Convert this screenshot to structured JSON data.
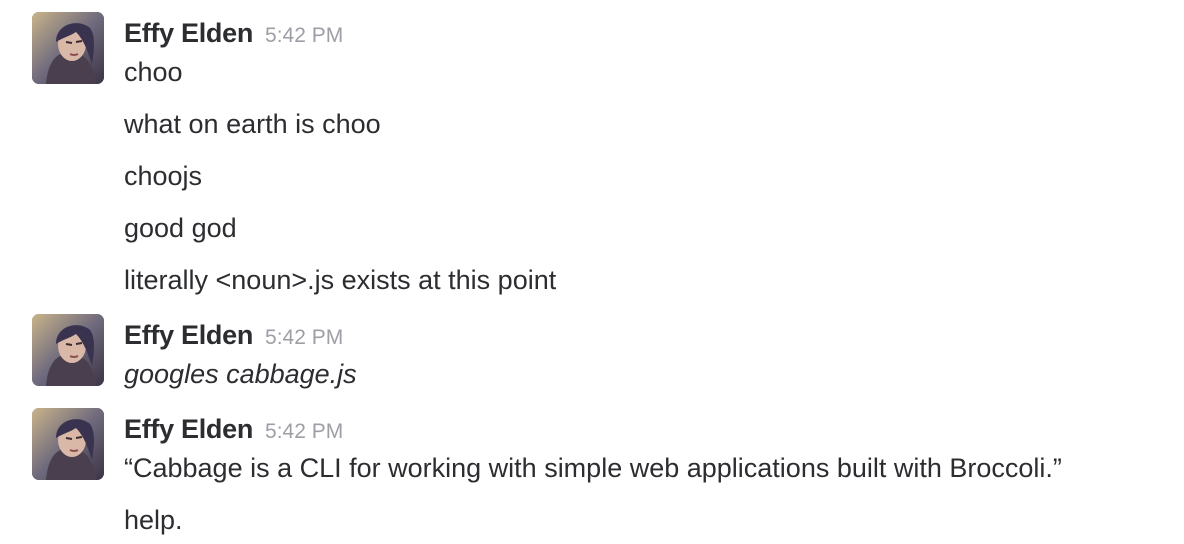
{
  "groups": [
    {
      "sender": "Effy Elden",
      "time": "5:42 PM",
      "messages": [
        {
          "text": "choo",
          "italic": false
        },
        {
          "text": "what on earth is choo",
          "italic": false
        },
        {
          "text": "choojs",
          "italic": false
        },
        {
          "text": "good god",
          "italic": false
        },
        {
          "text": "literally <noun>.js exists at this point",
          "italic": false
        }
      ]
    },
    {
      "sender": "Effy Elden",
      "time": "5:42 PM",
      "messages": [
        {
          "text": "googles cabbage.js",
          "italic": true
        }
      ]
    },
    {
      "sender": "Effy Elden",
      "time": "5:42 PM",
      "messages": [
        {
          "text": "“Cabbage is a CLI for working with simple web applications built with Broccoli.”",
          "italic": false
        },
        {
          "text": "help.",
          "italic": false
        }
      ]
    }
  ],
  "avatar_icon": "user-avatar-photo"
}
